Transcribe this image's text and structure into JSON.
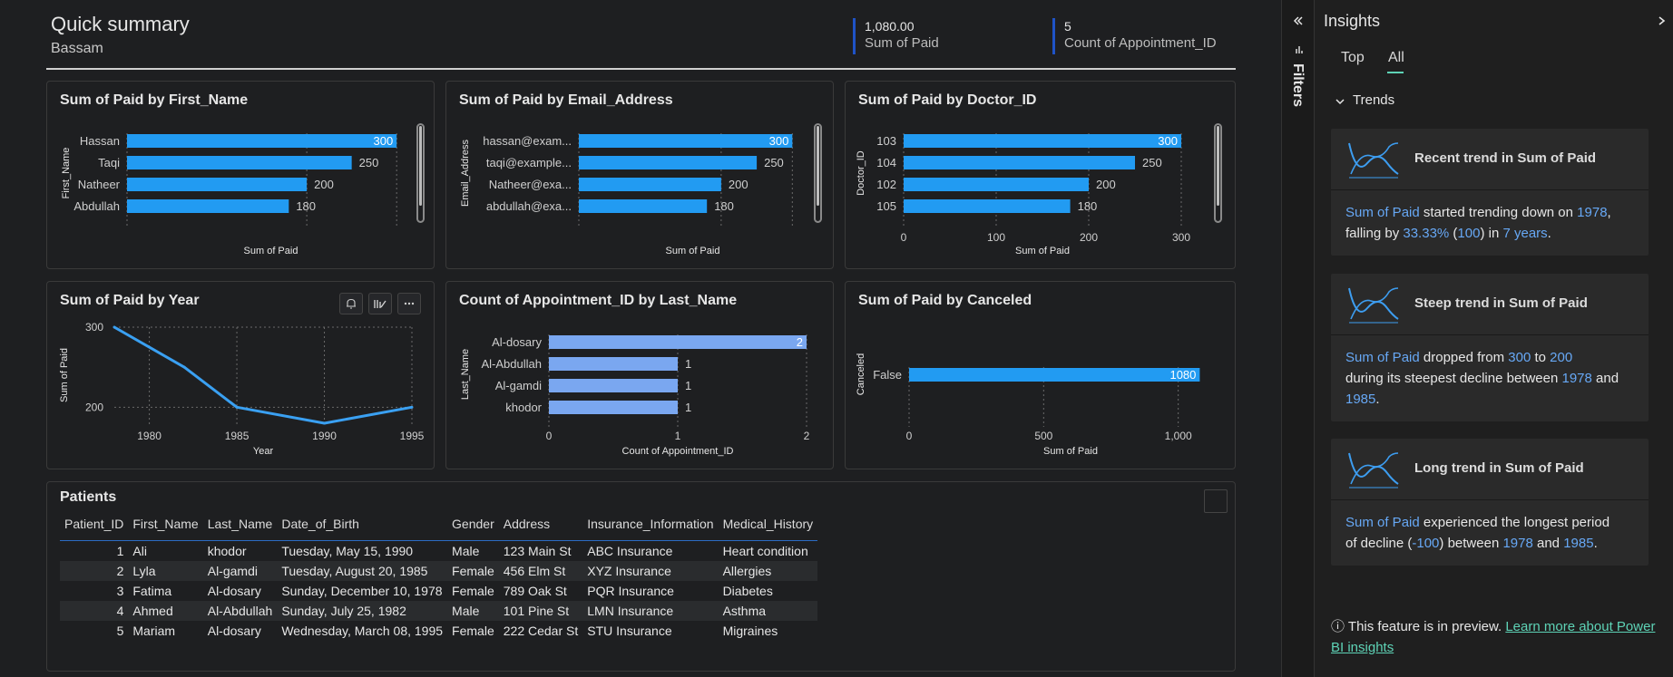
{
  "header": {
    "title": "Quick summary",
    "subtitle": "Bassam"
  },
  "kpis": [
    {
      "value": "1,080.00",
      "label": "Sum of Paid"
    },
    {
      "value": "5",
      "label": "Count of Appointment_ID"
    }
  ],
  "colors": {
    "bar": "#229bf2",
    "bar_light": "#7aa7f0",
    "kpi_accent": "#1f53c7",
    "accent_teal": "#5ed3b6",
    "highlight": "#67a8f5"
  },
  "chart_data": [
    {
      "type": "bar",
      "title": "Sum of Paid by First_Name",
      "xlabel": "Sum of Paid",
      "ylabel": "First_Name",
      "categories": [
        "Hassan",
        "Taqi",
        "Natheer",
        "Abdullah"
      ],
      "values": [
        300,
        250,
        200,
        180
      ],
      "xlim": [
        0,
        320
      ]
    },
    {
      "type": "bar",
      "title": "Sum of Paid by Email_Address",
      "xlabel": "Sum of Paid",
      "ylabel": "Email_Address",
      "categories": [
        "hassan@exam...",
        "taqi@example...",
        "Natheer@exa...",
        "abdullah@exa..."
      ],
      "values": [
        300,
        250,
        200,
        180
      ],
      "xlim": [
        0,
        320
      ]
    },
    {
      "type": "bar",
      "title": "Sum of Paid by Doctor_ID",
      "xlabel": "Sum of Paid",
      "ylabel": "Doctor_ID",
      "categories": [
        "103",
        "104",
        "102",
        "105"
      ],
      "values": [
        300,
        250,
        200,
        180
      ],
      "xticks": [
        "0",
        "100",
        "200",
        "300"
      ],
      "xlim": [
        0,
        300
      ]
    },
    {
      "type": "line",
      "title": "Sum of Paid by Year",
      "xlabel": "Year",
      "ylabel": "Sum of Paid",
      "x": [
        1978,
        1982,
        1985,
        1990,
        1995
      ],
      "values": [
        300,
        250,
        200,
        180,
        200
      ],
      "xticks": [
        "1980",
        "1985",
        "1990",
        "1995"
      ],
      "yticks": [
        "300",
        "200"
      ],
      "xlim": [
        1978,
        1995
      ],
      "ylim": [
        180,
        300
      ]
    },
    {
      "type": "bar",
      "title": "Count of Appointment_ID by Last_Name",
      "xlabel": "Count of Appointment_ID",
      "ylabel": "Last_Name",
      "categories": [
        "Al-dosary",
        "Al-Abdullah",
        "Al-gamdi",
        "khodor"
      ],
      "values": [
        2,
        1,
        1,
        1
      ],
      "xticks": [
        "0",
        "1",
        "2"
      ],
      "xlim": [
        0,
        2
      ]
    },
    {
      "type": "bar",
      "title": "Sum of Paid by Canceled",
      "xlabel": "Sum of Paid",
      "ylabel": "Canceled",
      "categories": [
        "False"
      ],
      "values": [
        1080
      ],
      "value_labels": [
        "1080"
      ],
      "xticks": [
        "0",
        "500",
        "1,000"
      ],
      "xlim": [
        0,
        1200
      ]
    }
  ],
  "patients": {
    "title": "Patients",
    "columns": [
      "Patient_ID",
      "First_Name",
      "Last_Name",
      "Date_of_Birth",
      "Gender",
      "Address",
      "Insurance_Information",
      "Medical_History"
    ],
    "rows": [
      [
        "1",
        "Ali",
        "khodor",
        "Tuesday, May 15, 1990",
        "Male",
        "123 Main St",
        "ABC Insurance",
        "Heart condition"
      ],
      [
        "2",
        "Lyla",
        "Al-gamdi",
        "Tuesday, August 20, 1985",
        "Female",
        "456 Elm St",
        "XYZ Insurance",
        "Allergies"
      ],
      [
        "3",
        "Fatima",
        "Al-dosary",
        "Sunday, December 10, 1978",
        "Female",
        "789 Oak St",
        "PQR Insurance",
        "Diabetes"
      ],
      [
        "4",
        "Ahmed",
        "Al-Abdullah",
        "Sunday, July 25, 1982",
        "Male",
        "101 Pine St",
        "LMN Insurance",
        "Asthma"
      ],
      [
        "5",
        "Mariam",
        "Al-dosary",
        "Wednesday, March 08, 1995",
        "Female",
        "222 Cedar St",
        "STU Insurance",
        "Migraines"
      ]
    ]
  },
  "filters": {
    "label": "Filters"
  },
  "insights": {
    "title": "Insights",
    "tabs": [
      "Top",
      "All"
    ],
    "section": "Trends",
    "cards": [
      {
        "title": "Recent trend in Sum of Paid",
        "parts": [
          [
            "Sum of Paid",
            true
          ],
          [
            " started trending down on ",
            false
          ],
          [
            "1978",
            true
          ],
          [
            ",\nfalling by ",
            false
          ],
          [
            "33.33%",
            true
          ],
          [
            " (",
            false
          ],
          [
            "100",
            true
          ],
          [
            ") in ",
            false
          ],
          [
            "7 years",
            true
          ],
          [
            ".",
            false
          ]
        ]
      },
      {
        "title": "Steep trend in Sum of Paid",
        "parts": [
          [
            "Sum of Paid",
            true
          ],
          [
            " dropped from ",
            false
          ],
          [
            "300",
            true
          ],
          [
            " to ",
            false
          ],
          [
            "200",
            true
          ],
          [
            "\nduring its steepest decline between ",
            false
          ],
          [
            "1978",
            true
          ],
          [
            " and\n",
            false
          ],
          [
            "1985",
            true
          ],
          [
            ".",
            false
          ]
        ]
      },
      {
        "title": "Long trend in Sum of Paid",
        "parts": [
          [
            "Sum of Paid",
            true
          ],
          [
            " experienced the longest period\nof decline (",
            false
          ],
          [
            "-100",
            true
          ],
          [
            ") between ",
            false
          ],
          [
            "1978",
            true
          ],
          [
            " and ",
            false
          ],
          [
            "1985",
            true
          ],
          [
            ".",
            false
          ]
        ]
      }
    ],
    "footer_text": "This feature is in preview. ",
    "footer_link": "Learn more about Power BI insights"
  }
}
